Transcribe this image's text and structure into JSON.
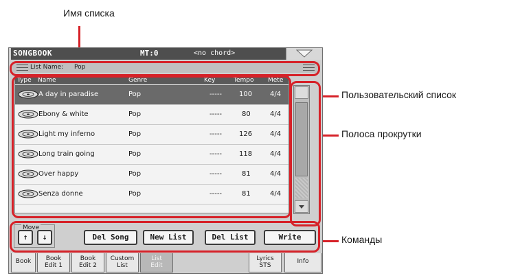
{
  "annotations": {
    "list_name": "Имя списка",
    "user_list": "Пользовательский список",
    "scrollbar": "Полоса прокрутки",
    "commands": "Команды"
  },
  "header": {
    "title": "SONGBOOK",
    "mt": "MT:0",
    "chord": "<no chord>"
  },
  "list_name": {
    "label": "List Name:",
    "value": "Pop"
  },
  "columns": [
    "Type",
    "Name",
    "Genre",
    "Key",
    "Tempo",
    "Mete"
  ],
  "rows": [
    {
      "name": "A day in paradise",
      "genre": "Pop",
      "key": "-----",
      "tempo": "100",
      "meter": "4/4"
    },
    {
      "name": "Ebony & white",
      "genre": "Pop",
      "key": "-----",
      "tempo": "80",
      "meter": "4/4"
    },
    {
      "name": "Light my inferno",
      "genre": "Pop",
      "key": "-----",
      "tempo": "126",
      "meter": "4/4"
    },
    {
      "name": "Long train going",
      "genre": "Pop",
      "key": "-----",
      "tempo": "118",
      "meter": "4/4"
    },
    {
      "name": "Over happy",
      "genre": "Pop",
      "key": "-----",
      "tempo": "81",
      "meter": "4/4"
    },
    {
      "name": "Senza donne",
      "genre": "Pop",
      "key": "-----",
      "tempo": "81",
      "meter": "4/4"
    }
  ],
  "commands": {
    "move_label": "Move",
    "up": "↑",
    "down": "↓",
    "del_song": "Del Song",
    "new_list": "New List",
    "del_list": "Del List",
    "write": "Write"
  },
  "tabs": {
    "book": "Book",
    "book_edit1_a": "Book",
    "book_edit1_b": "Edit 1",
    "book_edit2_a": "Book",
    "book_edit2_b": "Edit 2",
    "custom_a": "Custom",
    "custom_b": "List",
    "list_edit_a": "List",
    "list_edit_b": "Edit",
    "lyrics_a": "Lyrics",
    "lyrics_b": "STS",
    "info": "Info"
  },
  "colors": {
    "accent_red": "#d62128",
    "selected_row": "#6a6a6a"
  }
}
